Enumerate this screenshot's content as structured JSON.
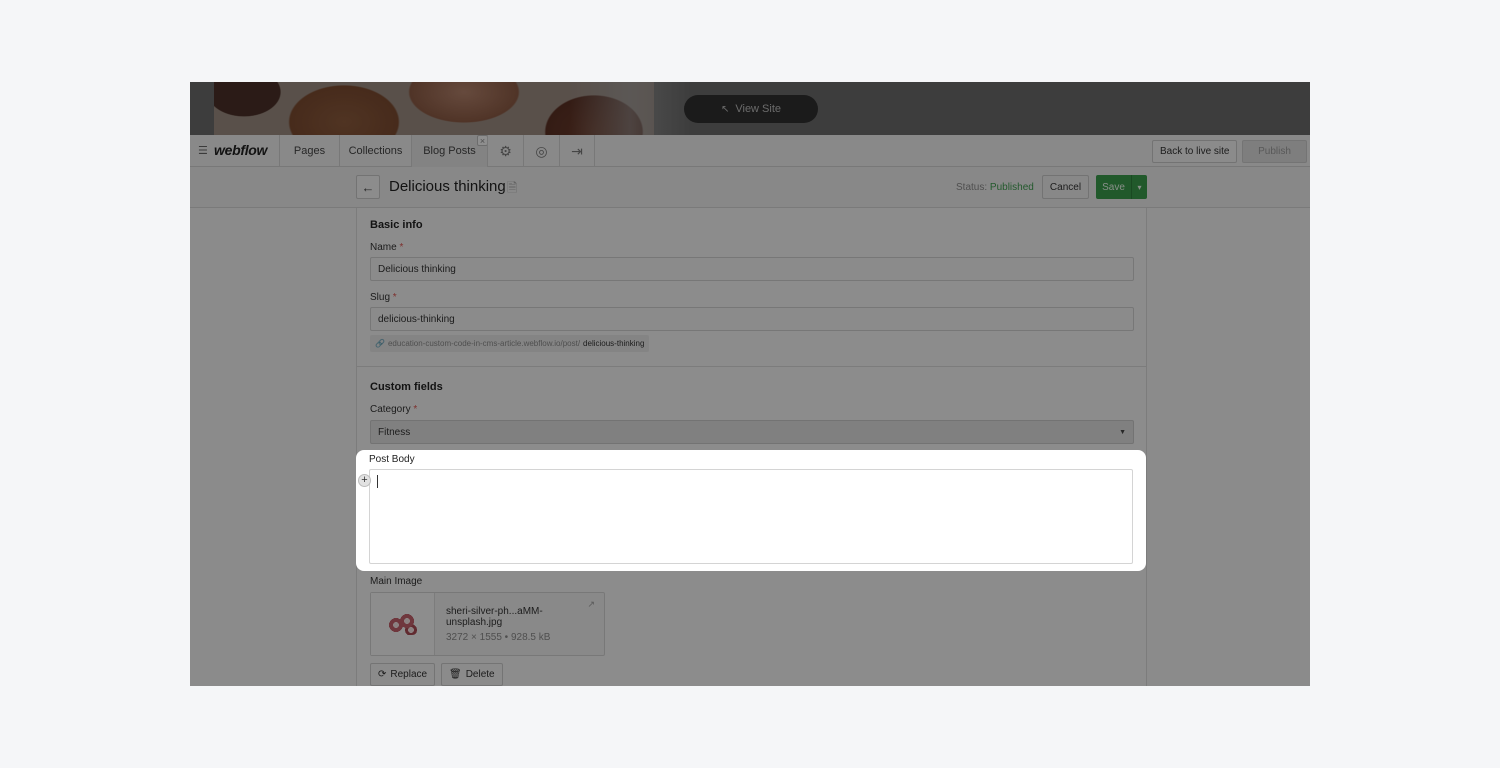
{
  "banner": {
    "view_site_label": "View Site"
  },
  "topbar": {
    "logo": "webflow",
    "tabs": [
      {
        "label": "Pages"
      },
      {
        "label": "Collections"
      },
      {
        "label": "Blog Posts"
      }
    ],
    "back_to_live_label": "Back to live site",
    "publish_label": "Publish"
  },
  "item_header": {
    "title": "Delicious thinking",
    "status_prefix": "Status:",
    "status_value": "Published",
    "cancel_label": "Cancel",
    "save_label": "Save"
  },
  "basic_info": {
    "title": "Basic info",
    "name_label": "Name",
    "name_value": "Delicious thinking",
    "slug_label": "Slug",
    "slug_value": "delicious-thinking",
    "url_prefix": "education-custom-code-in-cms-article.webflow.io/post/",
    "url_slug": "delicious-thinking",
    "required_mark": "*"
  },
  "custom_fields": {
    "title": "Custom fields",
    "category_label": "Category",
    "category_value": "Fitness",
    "post_body_label": "Post Body",
    "main_image_label": "Main Image",
    "image_filename": "sheri-silver-ph...aMM-unsplash.jpg",
    "image_meta": "3272 × 1555 • 928.5 kB",
    "replace_label": "Replace",
    "delete_label": "Delete"
  },
  "colors": {
    "accent_green": "#3a9a4a",
    "status_green": "#3d9a4e"
  }
}
